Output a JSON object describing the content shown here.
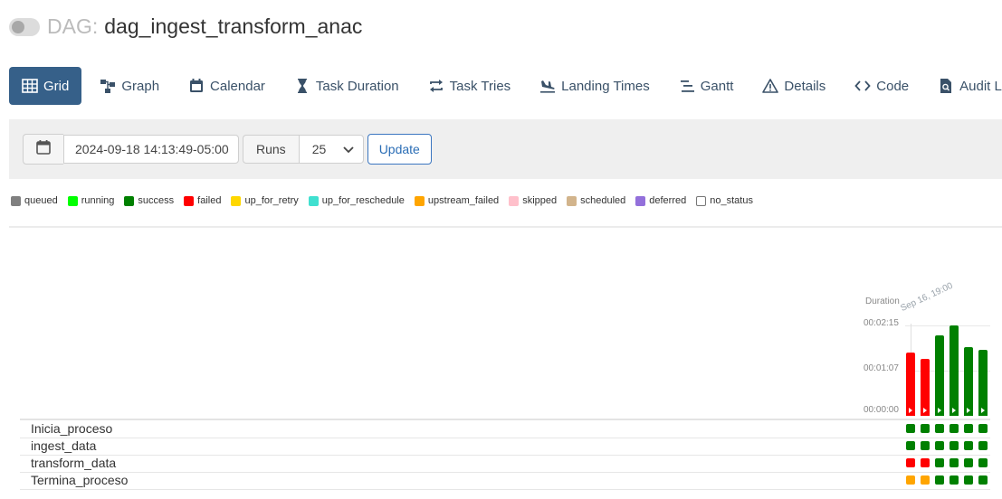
{
  "header": {
    "prefix": "DAG:",
    "dag_id": "dag_ingest_transform_anac"
  },
  "tabs": [
    {
      "label": "Grid",
      "icon": "grid-icon",
      "active": true
    },
    {
      "label": "Graph",
      "icon": "graph-icon"
    },
    {
      "label": "Calendar",
      "icon": "calendar-icon"
    },
    {
      "label": "Task Duration",
      "icon": "hourglass-icon"
    },
    {
      "label": "Task Tries",
      "icon": "retry-arrows-icon"
    },
    {
      "label": "Landing Times",
      "icon": "plane-landing-icon"
    },
    {
      "label": "Gantt",
      "icon": "gantt-icon"
    },
    {
      "label": "Details",
      "icon": "warning-triangle-icon"
    },
    {
      "label": "Code",
      "icon": "code-icon"
    },
    {
      "label": "Audit Log",
      "icon": "audit-file-icon"
    }
  ],
  "controls": {
    "base_date": "2024-09-18 14:13:49-05:00",
    "runs_label": "Runs",
    "runs_value": "25",
    "update_label": "Update"
  },
  "legend": [
    {
      "label": "queued",
      "color": "#808080"
    },
    {
      "label": "running",
      "color": "#00ff00"
    },
    {
      "label": "success",
      "color": "#008000"
    },
    {
      "label": "failed",
      "color": "#ff0000"
    },
    {
      "label": "up_for_retry",
      "color": "#ffd700"
    },
    {
      "label": "up_for_reschedule",
      "color": "#40e0d0"
    },
    {
      "label": "upstream_failed",
      "color": "#ffa500"
    },
    {
      "label": "skipped",
      "color": "#ffc0cb"
    },
    {
      "label": "scheduled",
      "color": "#d2b48c"
    },
    {
      "label": "deferred",
      "color": "#9370db"
    },
    {
      "label": "no_status",
      "color": "#ffffff"
    }
  ],
  "duration": {
    "title": "Duration",
    "first_run_label": "Sep 16, 19:00",
    "ticks": [
      "00:02:15",
      "00:01:07",
      "00:00:00"
    ],
    "max_seconds": 135,
    "runs": [
      {
        "seconds": 95,
        "state": "failed"
      },
      {
        "seconds": 85,
        "state": "failed"
      },
      {
        "seconds": 120,
        "state": "success"
      },
      {
        "seconds": 135,
        "state": "success"
      },
      {
        "seconds": 102,
        "state": "success"
      },
      {
        "seconds": 98,
        "state": "success"
      }
    ]
  },
  "state_colors": {
    "success": "#008000",
    "failed": "#ff0000",
    "upstream_failed": "#ffa500"
  },
  "tasks": [
    {
      "name": "Inicia_proceso",
      "states": [
        "success",
        "success",
        "success",
        "success",
        "success",
        "success"
      ]
    },
    {
      "name": "ingest_data",
      "states": [
        "success",
        "success",
        "success",
        "success",
        "success",
        "success"
      ]
    },
    {
      "name": "transform_data",
      "states": [
        "failed",
        "failed",
        "success",
        "success",
        "success",
        "success"
      ]
    },
    {
      "name": "Termina_proceso",
      "states": [
        "upstream_failed",
        "upstream_failed",
        "success",
        "success",
        "success",
        "success"
      ]
    }
  ]
}
